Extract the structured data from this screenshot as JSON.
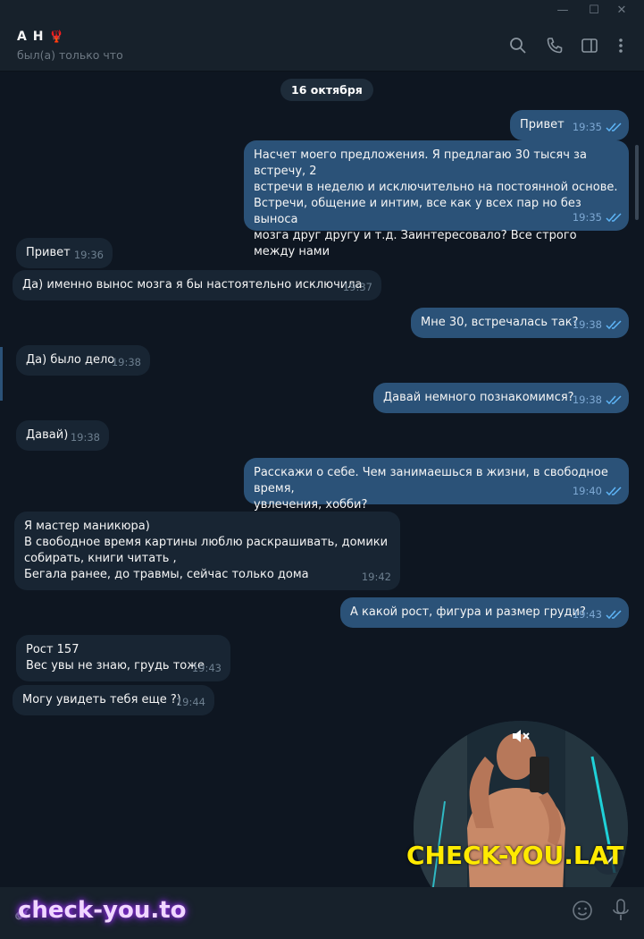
{
  "window": {
    "minimize_glyph": "—",
    "maximize_glyph": "☐",
    "close_glyph": "✕"
  },
  "header": {
    "name": "А Н",
    "name_emoji": "🦞",
    "status": "был(а) только что"
  },
  "chat": {
    "date": "16 октября",
    "messages": [
      {
        "dir": "out",
        "text": "Привет",
        "time": "19:35"
      },
      {
        "dir": "out",
        "text": "Насчет моего предложения. Я предлагаю 30 тысяч за встречу, 2\nвстречи в неделю и исключительно на постоянной основе.\nВстречи, общение и интим, все как у всех пар но без выноса\nмозга друг другу и т.д. Заинтересовало? Все строго между нами",
        "time": "19:35"
      },
      {
        "dir": "in",
        "text": "Привет",
        "time": "19:36"
      },
      {
        "dir": "in",
        "text": "Да) именно вынос мозга я бы настоятельно исключила",
        "time": "19:37"
      },
      {
        "dir": "out",
        "text": "Мне 30, встречалась так?",
        "time": "19:38"
      },
      {
        "dir": "in",
        "text": "Да) было дело",
        "time": "19:38"
      },
      {
        "dir": "out",
        "text": "Давай немного познакомимся?",
        "time": "19:38"
      },
      {
        "dir": "in",
        "text": "Давай)",
        "time": "19:38"
      },
      {
        "dir": "out",
        "text": "Расскажи о себе. Чем занимаешься в жизни, в свободное время,\nувлечения, хобби?",
        "time": "19:40"
      },
      {
        "dir": "in",
        "text": "Я мастер маникюра)\nВ свободное время картины люблю раскрашивать, домики\nсобирать, книги читать ,\nБегала ранее, до травмы, сейчас только дома",
        "time": "19:42"
      },
      {
        "dir": "out",
        "text": "А какой рост, фигура и размер груди?",
        "time": "19:43"
      },
      {
        "dir": "in",
        "text": "Рост 157\nВес увы не знаю, грудь тоже",
        "time": "19:43"
      },
      {
        "dir": "in",
        "text": "Могу увидеть тебя еще ?)",
        "time": "19:44"
      }
    ]
  },
  "watermarks": {
    "yellow": "CHECK-YOU.LAT",
    "purple": "check-you.to"
  },
  "colors": {
    "bg": "#0e1621",
    "header": "#17212b",
    "outgoing": "#2b5278",
    "incoming": "#182533",
    "accent": "#5eb5f7",
    "watermark_yellow": "#ffea00"
  },
  "icons": {
    "search": "search-icon",
    "call": "phone-icon",
    "sidebar": "sidebar-toggle-icon",
    "more": "more-vertical-icon",
    "emoji": "emoji-icon",
    "mic": "microphone-icon",
    "mute": "muted-speaker-icon",
    "read": "double-check-icon"
  }
}
